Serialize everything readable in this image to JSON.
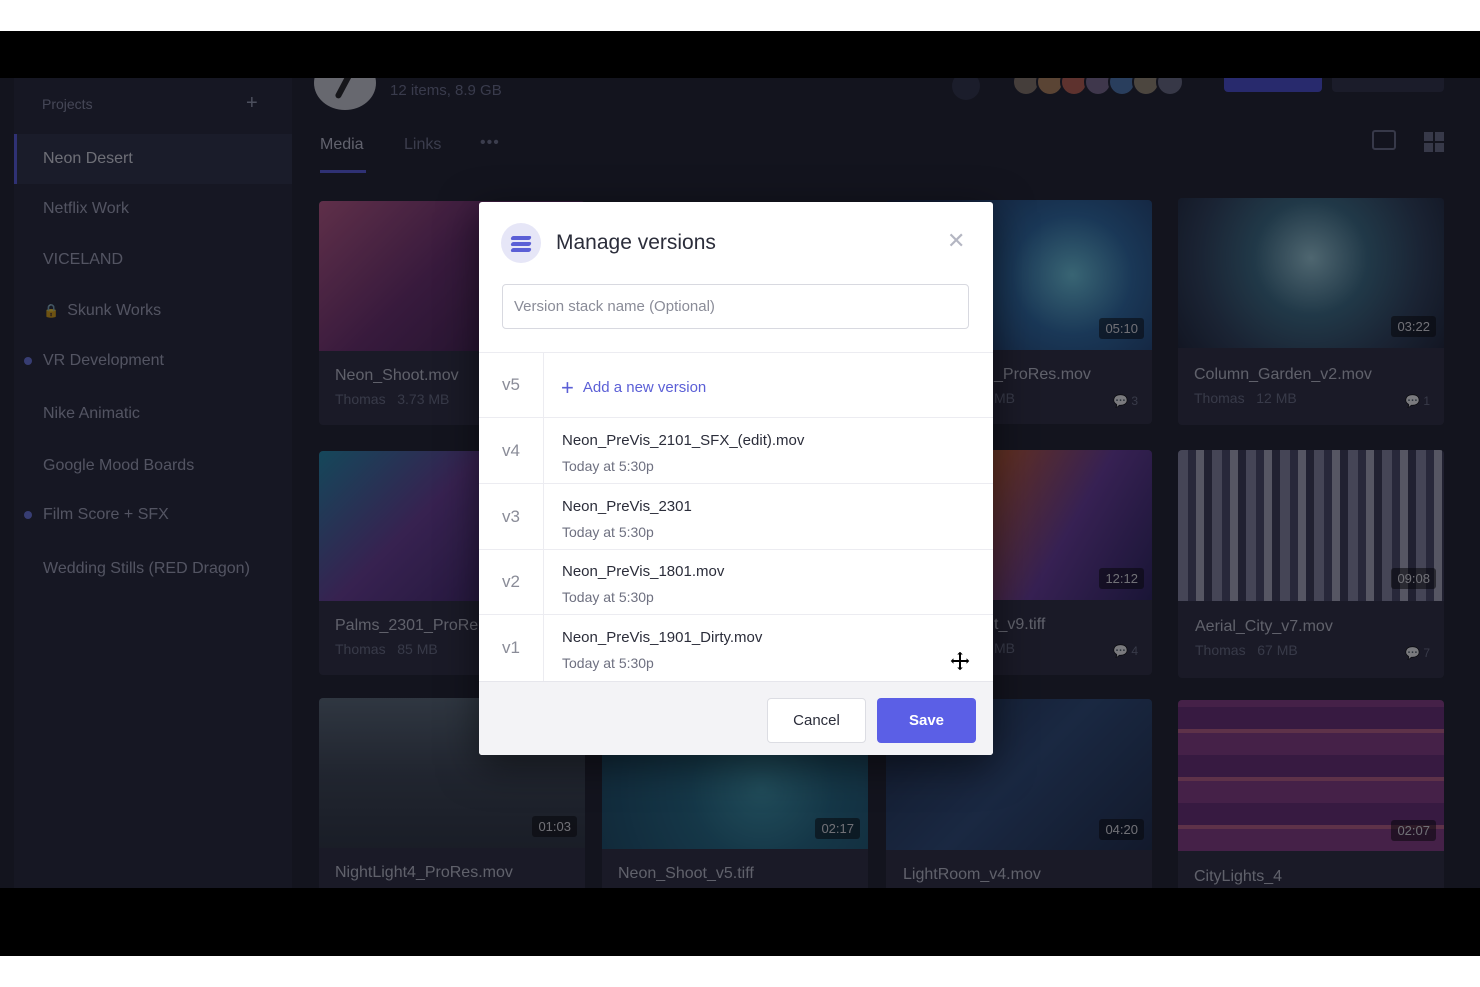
{
  "sidebar": {
    "header": "Projects",
    "items": [
      {
        "label": "Neon Desert",
        "active": true
      },
      {
        "label": "Netflix Work"
      },
      {
        "label": "VICELAND"
      },
      {
        "label": "Skunk Works",
        "locked": true
      },
      {
        "label": "VR Development",
        "dot": true
      },
      {
        "label": "Nike Animatic"
      },
      {
        "label": "Google Mood Boards"
      },
      {
        "label": "Film Score + SFX",
        "dot": true
      },
      {
        "label": "Wedding Stills (RED Dragon)"
      }
    ]
  },
  "header": {
    "project_meta": "12 items, 8.9 GB",
    "tabs": [
      "Media",
      "Links"
    ],
    "more": "•••"
  },
  "cards": [
    {
      "name": "Neon_Shoot.mov",
      "owner": "Thomas",
      "size": "3.73 MB"
    },
    {
      "name": "_ProRes.mov",
      "owner": "",
      "size": "MB",
      "duration": "05:10",
      "comments": "3"
    },
    {
      "name": "Column_Garden_v2.mov",
      "owner": "Thomas",
      "size": "12 MB",
      "duration": "03:22",
      "comments": "1"
    },
    {
      "name": "Palms_2301_ProRe",
      "owner": "Thomas",
      "size": "85 MB"
    },
    {
      "name": "t_v9.tiff",
      "owner": "",
      "size": "MB",
      "duration": "12:12",
      "comments": "4"
    },
    {
      "name": "Aerial_City_v7.mov",
      "owner": "Thomas",
      "size": "67 MB",
      "duration": "09:08",
      "comments": "7"
    },
    {
      "name": "NightLight4_ProRes.mov",
      "duration": "01:03"
    },
    {
      "name": "Neon_Shoot_v5.tiff",
      "duration": "02:17"
    },
    {
      "name": "LightRoom_v4.mov",
      "duration": "04:20"
    },
    {
      "name": "CityLights_4",
      "duration": "02:07"
    }
  ],
  "modal": {
    "title": "Manage versions",
    "close": "✕",
    "stack_placeholder": "Version stack name (Optional)",
    "add_row": {
      "version": "v5",
      "label": "Add a new version"
    },
    "versions": [
      {
        "version": "v4",
        "file": "Neon_PreVis_2101_SFX_(edit).mov",
        "time": "Today at 5:30p"
      },
      {
        "version": "v3",
        "file": "Neon_PreVis_2301",
        "time": "Today at 5:30p"
      },
      {
        "version": "v2",
        "file": "Neon_PreVis_1801.mov",
        "time": "Today at 5:30p"
      },
      {
        "version": "v1",
        "file": "Neon_PreVis_1901_Dirty.mov",
        "time": "Today at 5:30p"
      }
    ],
    "cancel_label": "Cancel",
    "save_label": "Save"
  },
  "colors": {
    "accent": "#5b5fe6",
    "app_bg": "#1b1d2a",
    "sidebar_bg": "#232536"
  },
  "icons": {
    "modal_logo": "stack-logo-icon",
    "close": "close-icon",
    "add": "plus-icon",
    "cursor": "move-cursor-icon"
  }
}
